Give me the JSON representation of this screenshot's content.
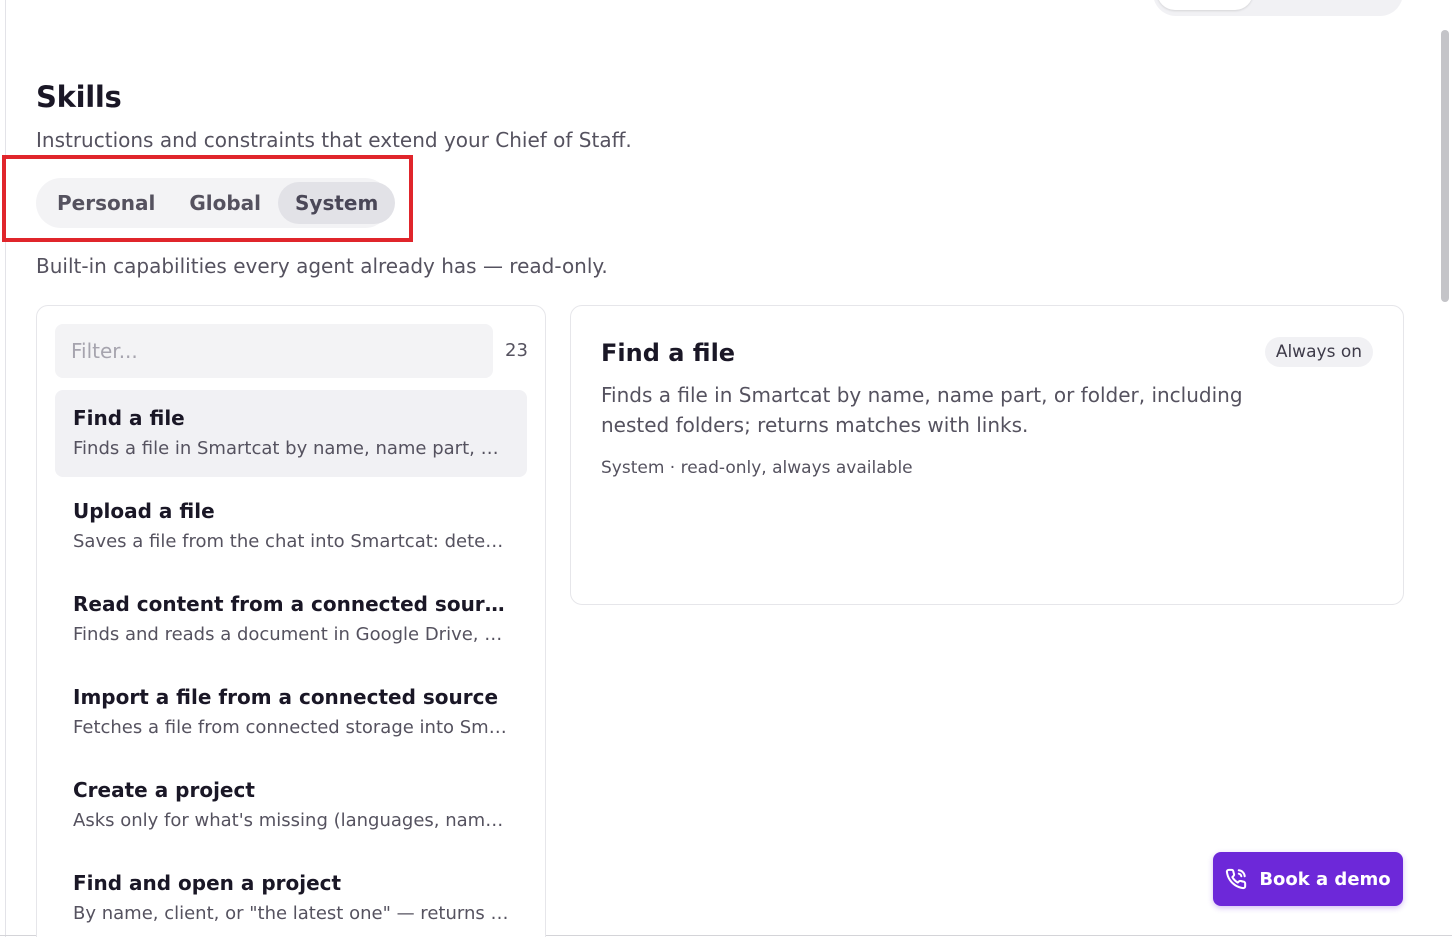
{
  "header": {
    "title": "Skills",
    "subtitle": "Instructions and constraints that extend your Chief of Staff."
  },
  "tabs": [
    {
      "label": "Personal",
      "active": false
    },
    {
      "label": "Global",
      "active": false
    },
    {
      "label": "System",
      "active": true
    }
  ],
  "tab_description": "Built-in capabilities every agent already has — read-only.",
  "list": {
    "filter_placeholder": "Filter...",
    "count": "23",
    "items": [
      {
        "title": "Find a file",
        "description": "Finds a file in Smartcat by name, name part, or fo...",
        "selected": true
      },
      {
        "title": "Upload a file",
        "description": "Saves a file from the chat into Smartcat: detects ...",
        "selected": false
      },
      {
        "title": "Read content from a connected source",
        "description": "Finds and reads a document in Google Drive, One...",
        "selected": false
      },
      {
        "title": "Import a file from a connected source",
        "description": "Fetches a file from connected storage into Smart...",
        "selected": false
      },
      {
        "title": "Create a project",
        "description": "Asks only for what's missing (languages, name) o...",
        "selected": false
      },
      {
        "title": "Find and open a project",
        "description": "By name, client, or \"the latest one\" — returns a cl...",
        "selected": false
      }
    ]
  },
  "detail": {
    "title": "Find a file",
    "badge": "Always on",
    "description": "Finds a file in Smartcat by name, name part, or folder, including nested folders; returns matches with links.",
    "meta": "System · read-only, always available"
  },
  "cta": {
    "label": "Book a demo",
    "icon": "phone-icon",
    "color": "#6d28d9"
  },
  "colors": {
    "accent": "#6d28d9",
    "highlight": "#e0252b"
  }
}
